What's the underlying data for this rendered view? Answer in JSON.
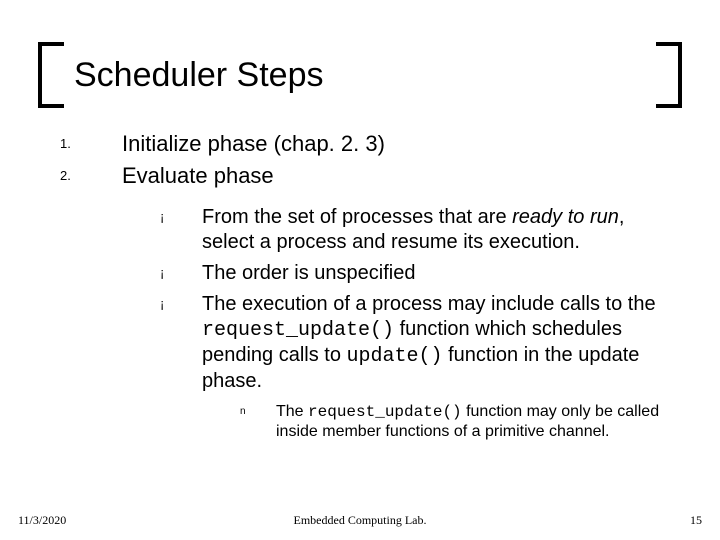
{
  "title": "Scheduler Steps",
  "steps": [
    {
      "n": "1.",
      "text": "Initialize phase (chap. 2. 3)"
    },
    {
      "n": "2.",
      "text": "Evaluate phase"
    }
  ],
  "sub": [
    {
      "bullet": "¡",
      "pre": "From the set of processes that are ",
      "em": "ready to run",
      "post": ", select a process and resume its execution."
    },
    {
      "bullet": "¡",
      "text": "The order is unspecified"
    },
    {
      "bullet": "¡",
      "a": "The execution of a process may include calls to the ",
      "code1": "request_update()",
      "b": " function which schedules pending calls to ",
      "code2": "update()",
      "c": " function in the update phase."
    }
  ],
  "subsub": {
    "sq": "n",
    "a": "The ",
    "code": "request_update()",
    "b": " function may only be called inside member functions of a primitive channel."
  },
  "footer": {
    "date": "11/3/2020",
    "center": "Embedded Computing Lab.",
    "page": "15"
  }
}
